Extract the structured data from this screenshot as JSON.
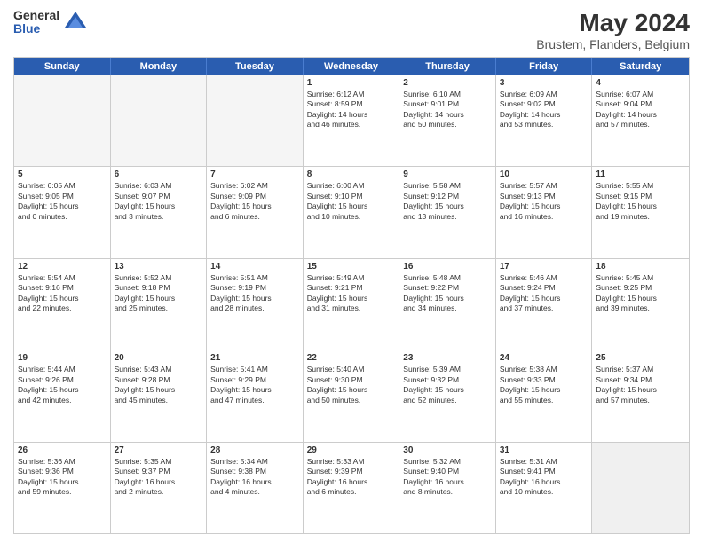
{
  "header": {
    "logo": {
      "general": "General",
      "blue": "Blue"
    },
    "title": "May 2024",
    "subtitle": "Brustem, Flanders, Belgium"
  },
  "weekdays": [
    "Sunday",
    "Monday",
    "Tuesday",
    "Wednesday",
    "Thursday",
    "Friday",
    "Saturday"
  ],
  "weeks": [
    [
      {
        "day": "",
        "content": ""
      },
      {
        "day": "",
        "content": ""
      },
      {
        "day": "",
        "content": ""
      },
      {
        "day": "1",
        "content": "Sunrise: 6:12 AM\nSunset: 8:59 PM\nDaylight: 14 hours\nand 46 minutes."
      },
      {
        "day": "2",
        "content": "Sunrise: 6:10 AM\nSunset: 9:01 PM\nDaylight: 14 hours\nand 50 minutes."
      },
      {
        "day": "3",
        "content": "Sunrise: 6:09 AM\nSunset: 9:02 PM\nDaylight: 14 hours\nand 53 minutes."
      },
      {
        "day": "4",
        "content": "Sunrise: 6:07 AM\nSunset: 9:04 PM\nDaylight: 14 hours\nand 57 minutes."
      }
    ],
    [
      {
        "day": "5",
        "content": "Sunrise: 6:05 AM\nSunset: 9:05 PM\nDaylight: 15 hours\nand 0 minutes."
      },
      {
        "day": "6",
        "content": "Sunrise: 6:03 AM\nSunset: 9:07 PM\nDaylight: 15 hours\nand 3 minutes."
      },
      {
        "day": "7",
        "content": "Sunrise: 6:02 AM\nSunset: 9:09 PM\nDaylight: 15 hours\nand 6 minutes."
      },
      {
        "day": "8",
        "content": "Sunrise: 6:00 AM\nSunset: 9:10 PM\nDaylight: 15 hours\nand 10 minutes."
      },
      {
        "day": "9",
        "content": "Sunrise: 5:58 AM\nSunset: 9:12 PM\nDaylight: 15 hours\nand 13 minutes."
      },
      {
        "day": "10",
        "content": "Sunrise: 5:57 AM\nSunset: 9:13 PM\nDaylight: 15 hours\nand 16 minutes."
      },
      {
        "day": "11",
        "content": "Sunrise: 5:55 AM\nSunset: 9:15 PM\nDaylight: 15 hours\nand 19 minutes."
      }
    ],
    [
      {
        "day": "12",
        "content": "Sunrise: 5:54 AM\nSunset: 9:16 PM\nDaylight: 15 hours\nand 22 minutes."
      },
      {
        "day": "13",
        "content": "Sunrise: 5:52 AM\nSunset: 9:18 PM\nDaylight: 15 hours\nand 25 minutes."
      },
      {
        "day": "14",
        "content": "Sunrise: 5:51 AM\nSunset: 9:19 PM\nDaylight: 15 hours\nand 28 minutes."
      },
      {
        "day": "15",
        "content": "Sunrise: 5:49 AM\nSunset: 9:21 PM\nDaylight: 15 hours\nand 31 minutes."
      },
      {
        "day": "16",
        "content": "Sunrise: 5:48 AM\nSunset: 9:22 PM\nDaylight: 15 hours\nand 34 minutes."
      },
      {
        "day": "17",
        "content": "Sunrise: 5:46 AM\nSunset: 9:24 PM\nDaylight: 15 hours\nand 37 minutes."
      },
      {
        "day": "18",
        "content": "Sunrise: 5:45 AM\nSunset: 9:25 PM\nDaylight: 15 hours\nand 39 minutes."
      }
    ],
    [
      {
        "day": "19",
        "content": "Sunrise: 5:44 AM\nSunset: 9:26 PM\nDaylight: 15 hours\nand 42 minutes."
      },
      {
        "day": "20",
        "content": "Sunrise: 5:43 AM\nSunset: 9:28 PM\nDaylight: 15 hours\nand 45 minutes."
      },
      {
        "day": "21",
        "content": "Sunrise: 5:41 AM\nSunset: 9:29 PM\nDaylight: 15 hours\nand 47 minutes."
      },
      {
        "day": "22",
        "content": "Sunrise: 5:40 AM\nSunset: 9:30 PM\nDaylight: 15 hours\nand 50 minutes."
      },
      {
        "day": "23",
        "content": "Sunrise: 5:39 AM\nSunset: 9:32 PM\nDaylight: 15 hours\nand 52 minutes."
      },
      {
        "day": "24",
        "content": "Sunrise: 5:38 AM\nSunset: 9:33 PM\nDaylight: 15 hours\nand 55 minutes."
      },
      {
        "day": "25",
        "content": "Sunrise: 5:37 AM\nSunset: 9:34 PM\nDaylight: 15 hours\nand 57 minutes."
      }
    ],
    [
      {
        "day": "26",
        "content": "Sunrise: 5:36 AM\nSunset: 9:36 PM\nDaylight: 15 hours\nand 59 minutes."
      },
      {
        "day": "27",
        "content": "Sunrise: 5:35 AM\nSunset: 9:37 PM\nDaylight: 16 hours\nand 2 minutes."
      },
      {
        "day": "28",
        "content": "Sunrise: 5:34 AM\nSunset: 9:38 PM\nDaylight: 16 hours\nand 4 minutes."
      },
      {
        "day": "29",
        "content": "Sunrise: 5:33 AM\nSunset: 9:39 PM\nDaylight: 16 hours\nand 6 minutes."
      },
      {
        "day": "30",
        "content": "Sunrise: 5:32 AM\nSunset: 9:40 PM\nDaylight: 16 hours\nand 8 minutes."
      },
      {
        "day": "31",
        "content": "Sunrise: 5:31 AM\nSunset: 9:41 PM\nDaylight: 16 hours\nand 10 minutes."
      },
      {
        "day": "",
        "content": ""
      }
    ]
  ]
}
